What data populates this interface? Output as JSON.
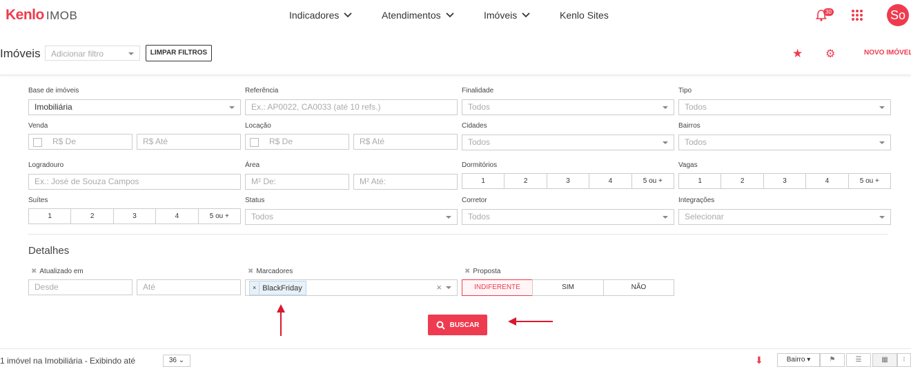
{
  "header": {
    "logo_brand": "Kenlo",
    "logo_product": "IMOB",
    "nav": [
      "Indicadores",
      "Atendimentos",
      "Imóveis",
      "Kenlo Sites"
    ],
    "notifications_count": "30",
    "avatar_initials": "So"
  },
  "toolbar": {
    "title": "Imóveis",
    "filter_placeholder": "Adicionar filtro",
    "clear_label": "LIMPAR FILTROS",
    "new_label": "NOVO IMÓVEL"
  },
  "filters": {
    "base": {
      "label": "Base de imóveis",
      "value": "Imobiliária"
    },
    "referencia": {
      "label": "Referência",
      "placeholder": "Ex.: AP0022, CA0033 (até 10 refs.)"
    },
    "finalidade": {
      "label": "Finalidade",
      "value": "Todos"
    },
    "tipo": {
      "label": "Tipo",
      "value": "Todos"
    },
    "venda": {
      "label": "Venda",
      "from": "R$ De",
      "to": "R$ Até"
    },
    "locacao": {
      "label": "Locação",
      "from": "R$ De",
      "to": "R$ Até"
    },
    "cidades": {
      "label": "Cidades",
      "value": "Todos"
    },
    "bairros": {
      "label": "Bairros",
      "value": "Todos"
    },
    "logradouro": {
      "label": "Logradouro",
      "placeholder": "Ex.: José de Souza Campos"
    },
    "area": {
      "label": "Área",
      "from": "M² De:",
      "to": "M² Até:"
    },
    "dormitorios": {
      "label": "Dormitórios",
      "options": [
        "1",
        "2",
        "3",
        "4",
        "5 ou +"
      ]
    },
    "vagas": {
      "label": "Vagas",
      "options": [
        "1",
        "2",
        "3",
        "4",
        "5 ou +"
      ]
    },
    "suites": {
      "label": "Suítes",
      "options": [
        "1",
        "2",
        "3",
        "4",
        "5 ou +"
      ]
    },
    "status": {
      "label": "Status",
      "value": "Todos"
    },
    "corretor": {
      "label": "Corretor",
      "value": "Todos"
    },
    "integracoes": {
      "label": "Integrações",
      "value": "Selecionar"
    }
  },
  "details": {
    "title": "Detalhes",
    "atualizado": {
      "label": "Atualizado em",
      "from": "Desde",
      "to": "Até"
    },
    "marcadores": {
      "label": "Marcadores",
      "tag": "BlackFriday"
    },
    "proposta": {
      "label": "Proposta",
      "options": [
        "INDIFERENTE",
        "SIM",
        "NÃO"
      ],
      "selected": "INDIFERENTE"
    }
  },
  "search_label": "BUSCAR",
  "footer": {
    "results_text": "1 imóvel na Imobiliária - Exibindo até",
    "per_page": "36",
    "sort_label": "Bairro"
  },
  "colors": {
    "accent": "#ef3b4f",
    "annotation_arrow": "#d9182d"
  }
}
